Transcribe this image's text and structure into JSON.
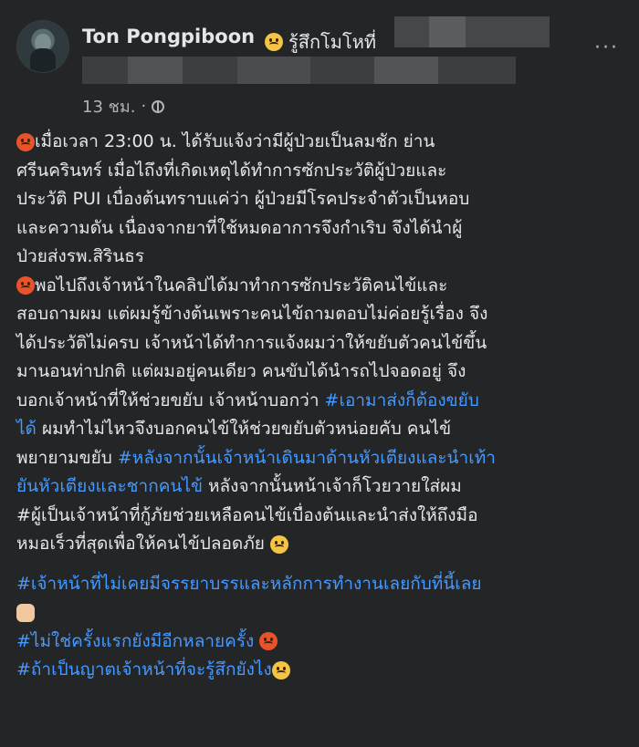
{
  "post": {
    "author": "Ton Pongpiboon",
    "feeling": "รู้สึกโมโหที่",
    "time": "13 ชม.",
    "separator": "·",
    "more_menu": "···",
    "icons": {
      "privacy": "globe-icon",
      "feeling": "frowning-face-emoji",
      "para": "angry-face-emoji"
    },
    "lines": [
      "เมื่อเวลา 23:00 น. ได้รับแจ้งว่ามีผู้ป่วยเป็นลมชัก ย่าน",
      "ศรีนครินทร์ เมื่อไถึงที่เกิดเหตุได้ทำการซักประวัติผู้ป่วยและ",
      "ประวัติ PUI เบื่องต้นทราบแค่ว่า ผู้ป่วยมีโรคประจำตัวเป็นหอบ",
      "และความดัน เนื่องจากยาที่ใช้หมดอาการจึงกำเริบ จึงได้นำผู้",
      "ป่วยส่งรพ.สิรินธร",
      "พอไปถึงเจ้าหน้าในคลิปได้มาทำการซักประวัติคนไข้และ",
      "สอบถามผม แต่ผมรู้ข้างต้นเพราะคนไข้ถามตอบไม่ค่อยรู้เรื่อง จึง",
      "ได้ประวัติไม่ครบ เจ้าหน้าได้ทำการแจ้งผมว่าให้ขยับตัวคนไข้ขึ้น",
      "มานอนท่าปกติ แต่ผมอยู่คนเดียว คนขับได้นำรถไปจอดอยู่ จึง",
      "บอกเจ้าหน้าที่ให้ช่วยขยับ เจ้าหน้าบอกว่า",
      "#เอามาส่งก็ต้องขยับ",
      "ได้",
      " ผมทำไม่ไหวจึงบอกคนไข้ให้ช่วยขยับตัวหน่อยคับ คนไข้",
      "พยายามขยับ ",
      "#หลังจากนั้นเจ้าหน้าเดินมาด้านหัวเตียงและนำเท้า",
      "ยันหัวเตียงและชากคนไข้",
      " หลังจากนั้นหน้าเจ้าก็โวยวายใส่ผม",
      "#ผู้เป็นเจ้าหน้าที่กู้ภัยช่วยเหลือคนไข้เบื่องต้นและนำส่งให้ถึงมือ",
      "หมอเร็วที่สุดเพื่อให้คนไข้ปลอดภัย"
    ],
    "hashtags": [
      "#เจ้าหน้าที่ไม่เคยมีจรรยาบรรและหลักการทำงานเลยกับที่นี้เลย",
      "#ไม่ใช่ครั้งแรกยังมีอีกหลายครั้ง",
      "#ถ้าเป็นญาตเจ้าหน้าที่จะรู้สึกยังไง"
    ]
  }
}
